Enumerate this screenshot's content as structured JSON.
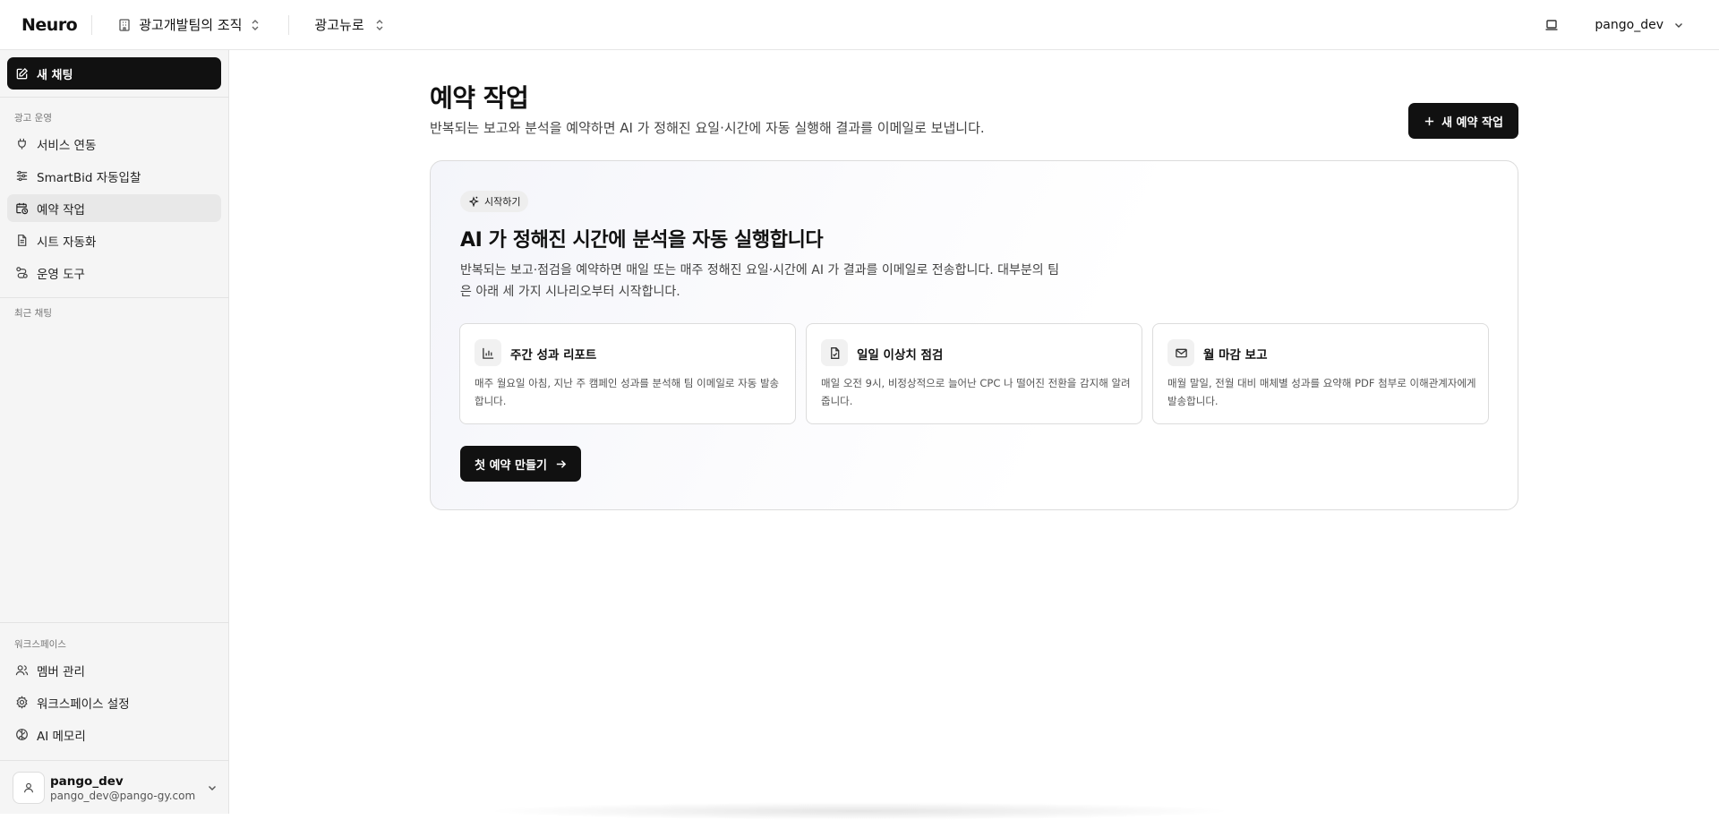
{
  "topbar": {
    "brand": "Neuro",
    "org_name": "광고개발팀의 조직",
    "project_name": "광고뉴로",
    "user_name": "pango_dev"
  },
  "sidebar": {
    "new_chat_label": "새 채팅",
    "section_ads": "광고 운영",
    "items": [
      {
        "label": "서비스 연동",
        "icon": "plug-icon"
      },
      {
        "label": "SmartBid 자동입찰",
        "icon": "sliders-icon"
      },
      {
        "label": "예약 작업",
        "icon": "calendar-clock-icon",
        "active": true
      },
      {
        "label": "시트 자동화",
        "icon": "document-icon"
      },
      {
        "label": "운영 도구",
        "icon": "route-icon"
      }
    ],
    "section_recent": "최근 채팅",
    "section_workspace": "워크스페이스",
    "workspace_items": [
      {
        "label": "멤버 관리",
        "icon": "users-icon"
      },
      {
        "label": "워크스페이스 설정",
        "icon": "gear-icon"
      },
      {
        "label": "AI 메모리",
        "icon": "brain-icon"
      }
    ],
    "user": {
      "name": "pango_dev",
      "email": "pango_dev@pango-gy.com"
    }
  },
  "main": {
    "title": "예약 작업",
    "subtitle": "반복되는 보고와 분석을 예약하면 AI 가 정해진 요일·시간에 자동 실행해 결과를 이메일로 보냅니다.",
    "new_job_label": "새 예약 작업",
    "hero": {
      "pill_label": "시작하기",
      "title": "AI 가 정해진 시간에 분석을 자동 실행합니다",
      "description": "반복되는 보고·점검을 예약하면 매일 또는 매주 정해진 요일·시간에 AI 가 결과를 이메일로 전송합니다. 대부분의 팀은 아래 세 가지 시나리오부터 시작합니다.",
      "cards": [
        {
          "title": "주간 성과 리포트",
          "description": "매주 월요일 아침, 지난 주 캠페인 성과를 분석해 팀 이메일로 자동 발송합니다.",
          "icon": "bar-chart-icon"
        },
        {
          "title": "일일 이상치 점검",
          "description": "매일 오전 9시, 비정상적으로 늘어난 CPC 나 떨어진 전환을 감지해 알려줍니다.",
          "icon": "file-check-icon"
        },
        {
          "title": "월 마감 보고",
          "description": "매월 말일, 전월 대비 매체별 성과를 요약해 PDF 첨부로 이해관계자에게 발송합니다.",
          "icon": "mail-icon"
        }
      ],
      "cta_label": "첫 예약 만들기"
    }
  }
}
